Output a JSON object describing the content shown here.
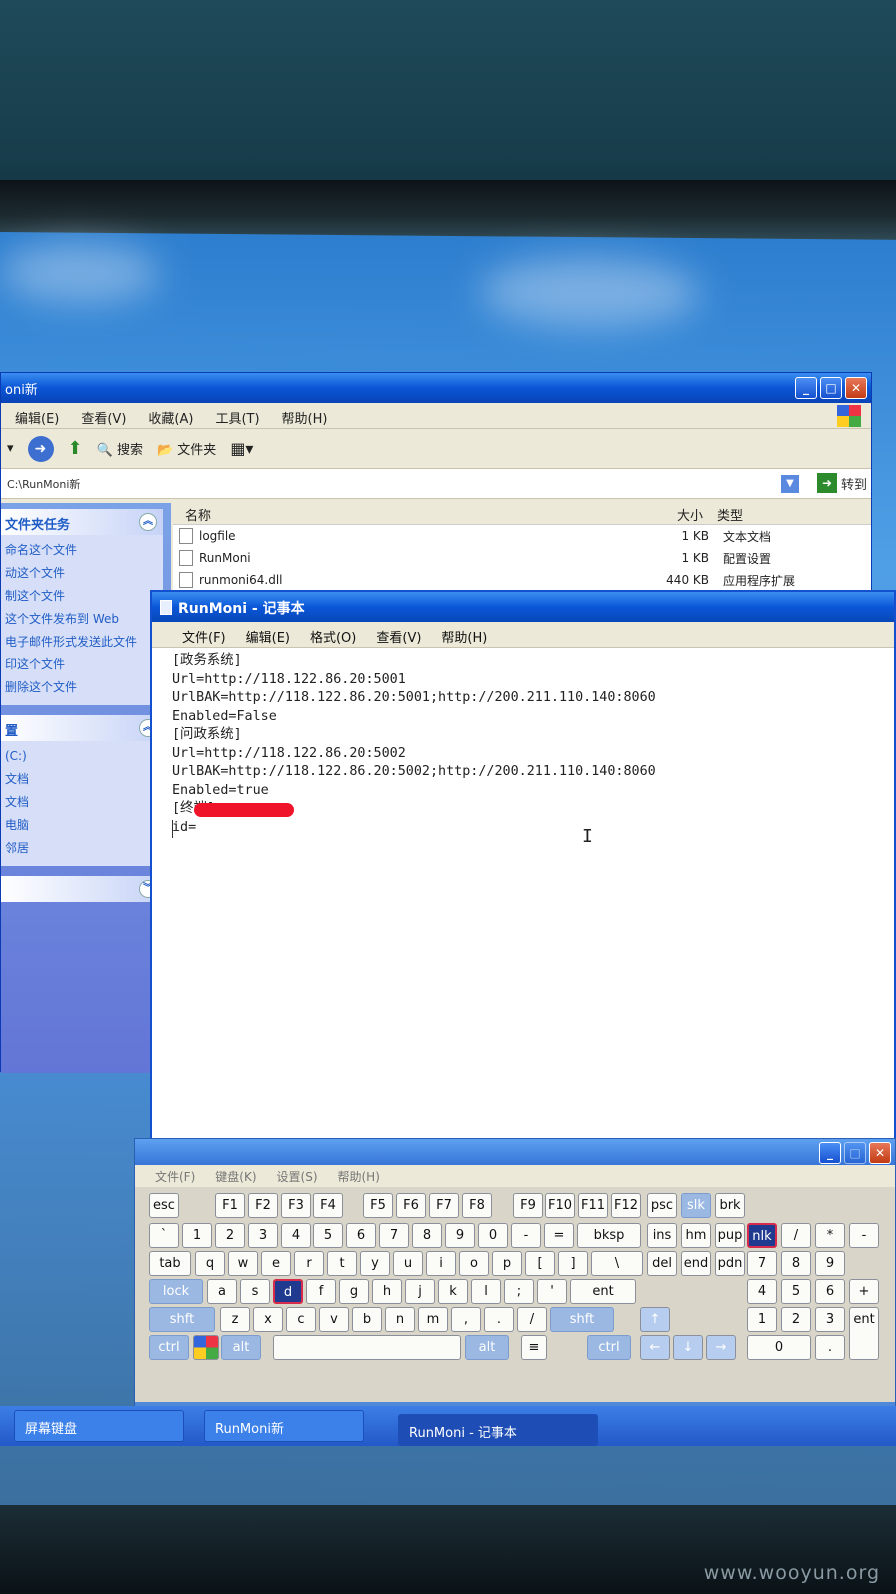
{
  "watermark": "www.wooyun.org",
  "explorer": {
    "title": "oni新",
    "menu": [
      "编辑(E)",
      "查看(V)",
      "收藏(A)",
      "工具(T)",
      "帮助(H)"
    ],
    "toolbar": {
      "search": "搜索",
      "folders": "文件夹"
    },
    "address": "C:\\RunMoni新",
    "go_label": "转到",
    "tasks_panel": {
      "title": "文件夹任务",
      "items": [
        "命名这个文件",
        "动这个文件",
        "制这个文件",
        "这个文件发布到 Web",
        "电子邮件形式发送此文件",
        "印这个文件",
        "删除这个文件"
      ]
    },
    "places_panel": {
      "title": "置",
      "items": [
        "(C:)",
        "文档",
        "文档",
        "电脑",
        "邻居"
      ]
    },
    "columns": {
      "name": "名称",
      "size": "大小",
      "type": "类型"
    },
    "files": [
      {
        "name": "logfile",
        "size": "1 KB",
        "type": "文本文档"
      },
      {
        "name": "RunMoni",
        "size": "1 KB",
        "type": "配置设置"
      },
      {
        "name": "runmoni64.dll",
        "size": "440 KB",
        "type": "应用程序扩展"
      }
    ]
  },
  "notepad": {
    "title": "RunMoni - 记事本",
    "menu": [
      "文件(F)",
      "编辑(E)",
      "格式(O)",
      "查看(V)",
      "帮助(H)"
    ],
    "lines": [
      "[政务系统]",
      "Url=http://118.122.86.20:5001",
      "UrlBAK=http://118.122.86.20:5001;http://200.211.110.140:8060",
      "Enabled=False",
      "[问政系统]",
      "Url=http://118.122.86.20:5002",
      "UrlBAK=http://118.122.86.20:5002;http://200.211.110.140:8060",
      "Enabled=true",
      "[终端]",
      "id="
    ]
  },
  "keyboard": {
    "menu": [
      "文件(F)",
      "键盘(K)",
      "设置(S)",
      "帮助(H)"
    ],
    "rows": {
      "fn": [
        "esc",
        "F1",
        "F2",
        "F3",
        "F4",
        "F5",
        "F6",
        "F7",
        "F8",
        "F9",
        "F10",
        "F11",
        "F12",
        "psc",
        "slk",
        "brk"
      ],
      "num": [
        "`",
        "1",
        "2",
        "3",
        "4",
        "5",
        "6",
        "7",
        "8",
        "9",
        "0",
        "-",
        "=",
        "bksp",
        "ins",
        "hm",
        "pup",
        "nlk",
        "/",
        "*",
        "-"
      ],
      "top": [
        "tab",
        "q",
        "w",
        "e",
        "r",
        "t",
        "y",
        "u",
        "i",
        "o",
        "p",
        "[",
        "]",
        "\\",
        "del",
        "end",
        "pdn",
        "7",
        "8",
        "9"
      ],
      "home": [
        "lock",
        "a",
        "s",
        "d",
        "f",
        "g",
        "h",
        "j",
        "k",
        "l",
        ";",
        "'",
        "ent",
        "4",
        "5",
        "6",
        "+"
      ],
      "bottom": [
        "shft",
        "z",
        "x",
        "c",
        "v",
        "b",
        "n",
        "m",
        ",",
        ".",
        "/",
        "shft",
        "↑",
        "1",
        "2",
        "3"
      ],
      "space": [
        "ctrl",
        "alt",
        "alt",
        "ctrl",
        "←",
        "↓",
        "→",
        "0",
        ".",
        "ent"
      ]
    },
    "selected_key": "d"
  },
  "taskbar": {
    "items": [
      "屏幕键盘",
      "RunMoni新",
      "RunMoni - 记事本"
    ]
  },
  "colors": {
    "titlebar": "#0a57d8",
    "redaction": "#f0142b",
    "desktop": "#4f9fe6"
  }
}
